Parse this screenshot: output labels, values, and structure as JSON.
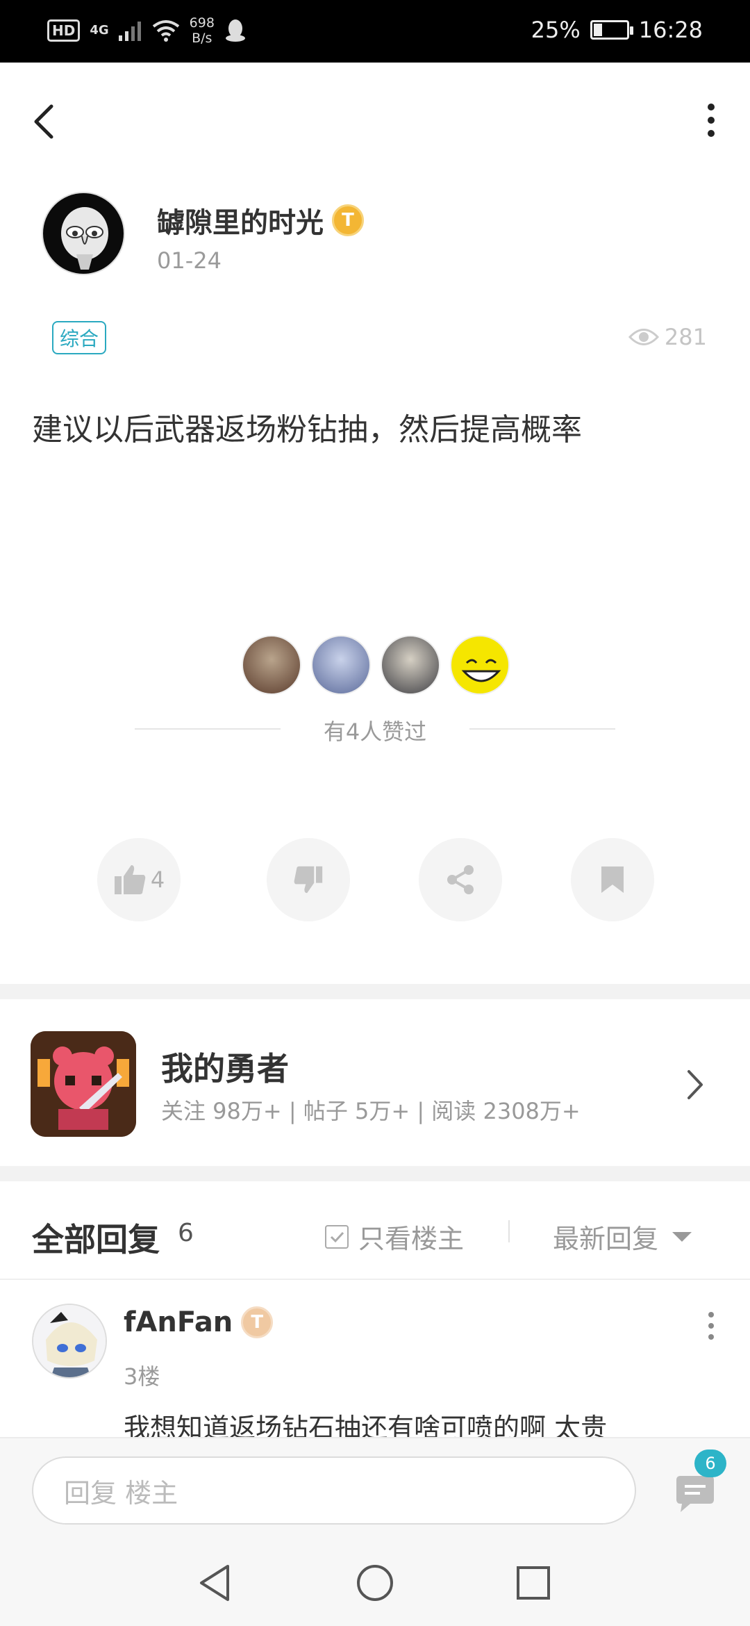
{
  "status_bar": {
    "hd": "HD",
    "network": "4G",
    "speed_value": "698",
    "speed_unit": "B/s",
    "battery": "25%",
    "battery_level": 0.25,
    "time": "16:28"
  },
  "post": {
    "author": "罅隙里的时光",
    "author_badge": "T",
    "date": "01-24",
    "tag": "综合",
    "views": "281",
    "body": "建议以后武器返场粉钻抽，然后提高概率",
    "liked_by_text": "有4人赞过",
    "like_count": "4"
  },
  "game": {
    "title": "我的勇者",
    "stats": "关注 98万+ | 帖子 5万+ | 阅读 2308万+"
  },
  "replies": {
    "title": "全部回复",
    "count": "6",
    "only_op_label": "只看楼主",
    "sort_label": "最新回复",
    "items": [
      {
        "name": "fAnFan",
        "badge": "T",
        "floor": "3楼",
        "text": "我想知道返场钻石抽还有啥可喷的啊  太贵"
      }
    ]
  },
  "bottom": {
    "input_placeholder": "回复  楼主",
    "comment_badge": "6"
  },
  "colors": {
    "accent": "#2aa9c0",
    "badge_gold": "#f3b634",
    "muted": "#9a9a9a"
  }
}
